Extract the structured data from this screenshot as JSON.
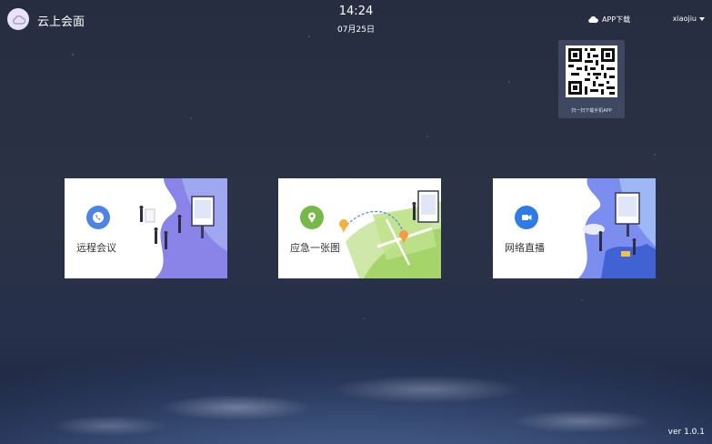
{
  "header": {
    "app_title": "云上会面",
    "time": "14:24",
    "date": "07月25日",
    "app_download_label": "APP下载",
    "username": "xiaojiu"
  },
  "qr": {
    "caption": "扫一扫下载手机APP"
  },
  "cards": [
    {
      "label": "远程会议",
      "icon": "phone-icon",
      "accent": "#4e84e6"
    },
    {
      "label": "应急一张图",
      "icon": "map-pin-icon",
      "accent": "#76b84a"
    },
    {
      "label": "网络直播",
      "icon": "video-camera-icon",
      "accent": "#2e7be6"
    }
  ],
  "footer": {
    "version": "ver 1.0.1"
  }
}
